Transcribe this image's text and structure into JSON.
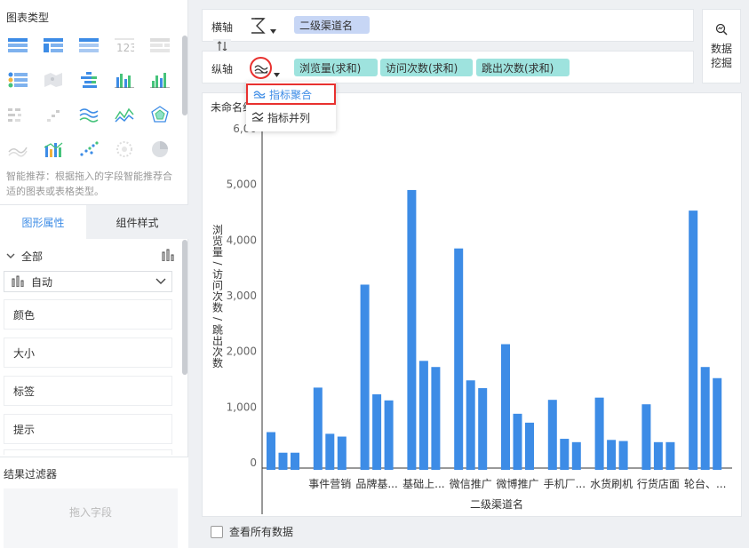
{
  "left": {
    "chart_type_title": "图表类型",
    "chart_type_icons": [
      "table-icon",
      "cross-table-icon",
      "grouped-table-icon",
      "kpi-number-icon",
      "detail-table-icon",
      "tree-table-icon",
      "map-icon",
      "stacked-bar-icon",
      "bar-chart-icon",
      "column-chart-icon",
      "heat-grid-icon",
      "scatter-grid-icon",
      "multi-line-icon",
      "line-chart-icon",
      "radar-chart-icon",
      "area-line-icon",
      "combo-chart-icon",
      "scatter-chart-icon",
      "dot-cloud-icon",
      "pie-chart-icon"
    ],
    "recommend_text": "智能推荐：根据拖入的字段智能推荐合适的图表或表格类型。",
    "tabs": [
      {
        "label": "图形属性"
      },
      {
        "label": "组件样式"
      }
    ],
    "all_label": "全部",
    "auto_label": "自动",
    "props": [
      {
        "label": "颜色"
      },
      {
        "label": "大小"
      },
      {
        "label": "标签"
      },
      {
        "label": "提示"
      }
    ],
    "filter_title": "结果过滤器",
    "drag_field_placeholder": "拖入字段"
  },
  "axes": {
    "x_label": "横轴",
    "y_label": "纵轴",
    "x_fields": [
      "二级渠道名"
    ],
    "y_fields": [
      "浏览量(求和)",
      "访问次数(求和)",
      "跳出次数(求和)"
    ]
  },
  "mining_button": {
    "line1": "数据",
    "line2": "挖掘"
  },
  "dropdown": {
    "items": [
      {
        "label": "指标聚合"
      },
      {
        "label": "指标并列"
      }
    ]
  },
  "chart": {
    "title": "未命名组",
    "show_all_label": "查看所有数据"
  },
  "chart_data": {
    "type": "bar",
    "title": "未命名组",
    "xlabel": "二级渠道名",
    "ylabel": "浏览量/访问次数/跳出次数",
    "ylim": [
      0,
      6000
    ],
    "yticks": [
      0,
      1000,
      2000,
      3000,
      4000,
      5000,
      6000
    ],
    "ytick_labels": [
      "0",
      "1,000",
      "2,000",
      "3,000",
      "4,000",
      "5,000",
      "6,00"
    ],
    "categories": [
      "",
      "事件营销",
      "品牌基...",
      "基础上...",
      "微信推广",
      "微博推广",
      "手机厂...",
      "水货刷机",
      "行货店面",
      "轮台、..."
    ],
    "series": [
      {
        "values": [
          550,
          1350,
          3200,
          4900,
          3850,
          2130,
          1130,
          1170,
          1050,
          4530
        ]
      },
      {
        "values": [
          180,
          520,
          1230,
          1830,
          1480,
          880,
          430,
          410,
          370,
          1720
        ]
      },
      {
        "values": [
          180,
          470,
          1120,
          1720,
          1340,
          720,
          370,
          390,
          370,
          1520
        ]
      }
    ],
    "bar_color": "#3d8ce6"
  },
  "colors": {
    "accent": "#3d8ce6",
    "pill": "#9ee3de",
    "highlight": "#e8312f"
  }
}
